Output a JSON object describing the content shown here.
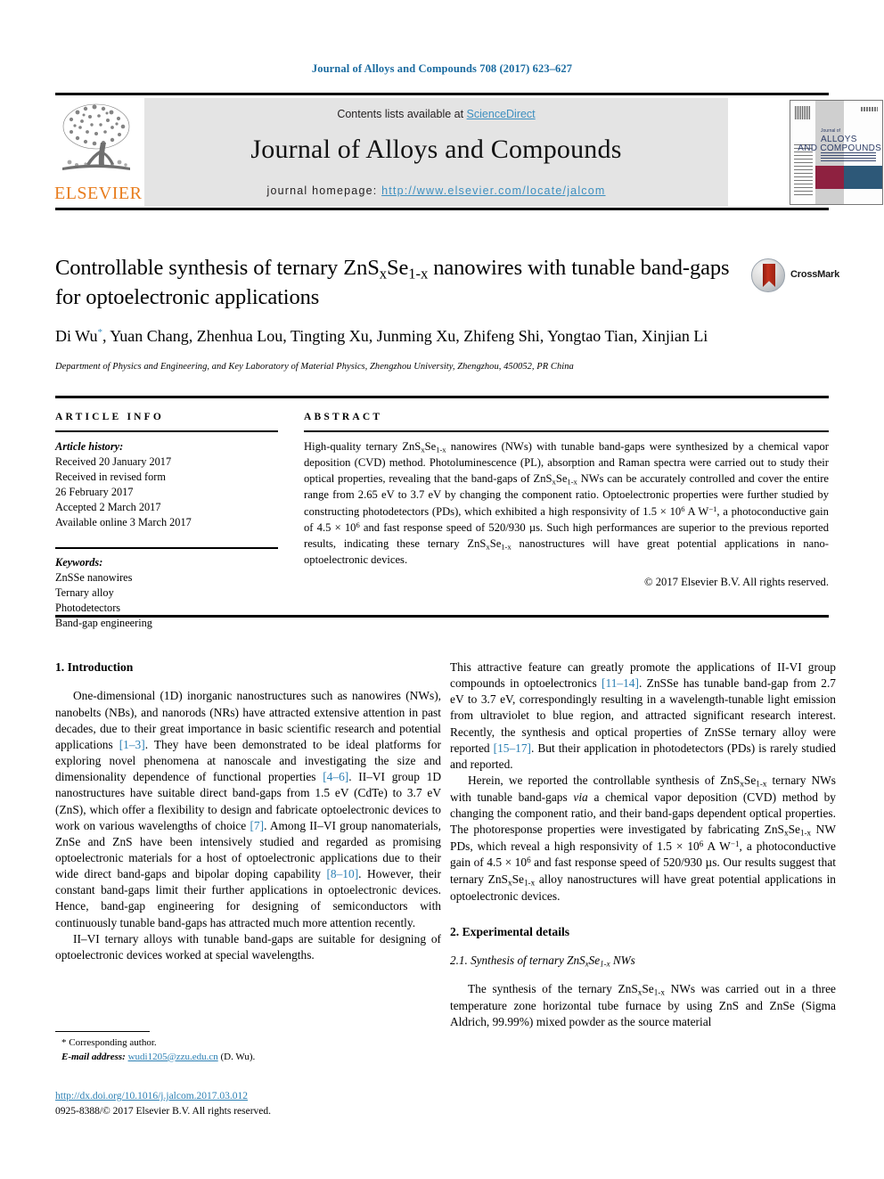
{
  "running_head": "Journal of Alloys and Compounds 708 (2017) 623–627",
  "masthead": {
    "contents_prefix": "Contents lists available at ",
    "sciencedirect": "ScienceDirect",
    "journal_title": "Journal of Alloys and Compounds",
    "homepage_label": "journal homepage: ",
    "homepage_url": "http://www.elsevier.com/locate/jalcom",
    "publisher_logo_text": "ELSEVIER",
    "cover": {
      "line1": "Journal of",
      "line2": "ALLOYS",
      "line3": "AND COMPOUNDS"
    }
  },
  "article": {
    "title_line1": "Controllable synthesis of ternary ZnS",
    "title_sub1": "x",
    "title_mid": "Se",
    "title_sub2": "1-x",
    "title_line1_end": " nanowires with tunable",
    "title_line2": "band-gaps for optoelectronic applications",
    "authors": "Di Wu*, Yuan Chang, Zhenhua Lou, Tingting Xu, Junming Xu, Zhifeng Shi, Yongtao Tian, Xinjian Li",
    "affiliation": "Department of Physics and Engineering, and Key Laboratory of Material Physics, Zhengzhou University, Zhengzhou, 450052, PR China",
    "crossmark_label": "CrossMark"
  },
  "article_info": {
    "heading": "ARTICLE INFO",
    "history_label": "Article history:",
    "history_lines": [
      "Received 20 January 2017",
      "Received in revised form",
      "26 February 2017",
      "Accepted 2 March 2017",
      "Available online 3 March 2017"
    ],
    "keywords_label": "Keywords:",
    "keywords": [
      "ZnSSe nanowires",
      "Ternary alloy",
      "Photodetectors",
      "Band-gap engineering"
    ]
  },
  "abstract": {
    "heading": "ABSTRACT",
    "copyright": "© 2017 Elsevier B.V. All rights reserved."
  },
  "sections": {
    "introduction_heading": "1. Introduction",
    "experimental_heading": "2. Experimental details",
    "synthesis_subheading_pre": "2.1. Synthesis of ternary ZnS",
    "synthesis_subheading_post": " NWs"
  },
  "footnote": {
    "corresponding": "* Corresponding author.",
    "email_label": "E-mail address:",
    "email": "wudi1205@zzu.edu.cn",
    "email_suffix": " (D. Wu)."
  },
  "footer": {
    "doi": "http://dx.doi.org/10.1016/j.jalcom.2017.03.012",
    "issn_line": "0925-8388/© 2017 Elsevier B.V. All rights reserved."
  },
  "colors": {
    "link_blue": "#2b7fb3",
    "header_blue": "#1a6ba0",
    "sciencedirect_blue": "#3d8fc0",
    "elsevier_orange": "#e87d1e",
    "banner_gray": "#e4e4e4",
    "crossmark_red": "#c4311d"
  }
}
